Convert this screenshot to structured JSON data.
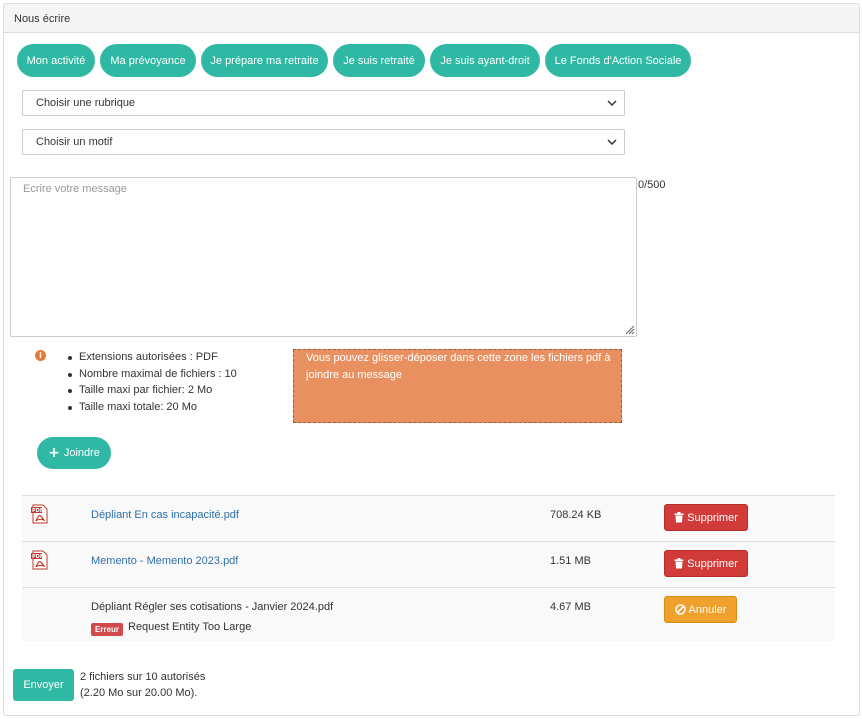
{
  "panel": {
    "title": "Nous écrire"
  },
  "tabs": [
    {
      "label": "Mon activité"
    },
    {
      "label": "Ma prévoyance"
    },
    {
      "label": "Je prépare ma retraite"
    },
    {
      "label": "Je suis retraité"
    },
    {
      "label": "Je suis ayant-droit"
    },
    {
      "label": "Le Fonds d'Action Sociale"
    }
  ],
  "selects": {
    "rubrique": {
      "value": "Choisir une rubrique"
    },
    "motif": {
      "value": "Choisir un motif"
    }
  },
  "message": {
    "placeholder": "Ecrire votre message",
    "counter": "0/500"
  },
  "rules": [
    "Extensions autorisées : PDF",
    "Nombre maximal de fichiers : 10",
    "Taille maxi par fichier: 2 Mo",
    "Taille maxi totale: 20 Mo"
  ],
  "dropzone": {
    "text": "Vous pouvez glisser-déposer dans cette zone les fichiers pdf à joindre au message"
  },
  "join_label": "Joindre",
  "files": [
    {
      "name": "Dépliant En cas incapacité.pdf",
      "size": "708.24 KB",
      "action": "Supprimer"
    },
    {
      "name": "Memento - Memento 2023.pdf",
      "size": "1.51 MB",
      "action": "Supprimer"
    },
    {
      "name": "Dépliant Régler ses cotisations - Janvier 2024.pdf",
      "size": "4.67 MB",
      "action": "Annuler",
      "error_badge": "Erreur",
      "error_message": "Request Entity Too Large"
    }
  ],
  "send_label": "Envoyer",
  "summary": {
    "line1": "2 fichiers sur 10 autorisés",
    "line2": "(2.20 Mo sur 20.00 Mo)."
  },
  "colors": {
    "accent": "#2fb8a4",
    "danger": "#d13b39",
    "warning": "#efa12b",
    "dropzone": "#e99061",
    "link": "#2f6fa8"
  }
}
